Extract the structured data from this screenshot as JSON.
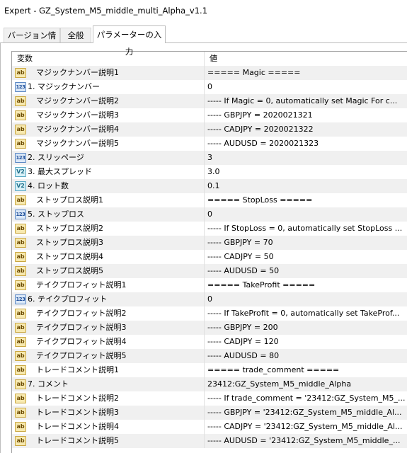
{
  "window": {
    "title": "Expert - GZ_System_M5_middle_multi_Alpha_v1.1"
  },
  "tabs": [
    {
      "label": "バージョン情報"
    },
    {
      "label": "全般"
    },
    {
      "label": "パラメーターの入力"
    }
  ],
  "table": {
    "columns": [
      "変数",
      "値"
    ],
    "rows": [
      {
        "icon": "ab",
        "indent": true,
        "name": "マジックナンバー説明1",
        "value": "===== Magic ====="
      },
      {
        "icon": "123",
        "indent": false,
        "name": "1. マジックナンバー",
        "value": "0"
      },
      {
        "icon": "ab",
        "indent": true,
        "name": "マジックナンバー説明2",
        "value": "----- If Magic = 0, automatically set Magic For c..."
      },
      {
        "icon": "ab",
        "indent": true,
        "name": "マジックナンバー説明3",
        "value": "----- GBPJPY = 2020021321"
      },
      {
        "icon": "ab",
        "indent": true,
        "name": "マジックナンバー説明4",
        "value": "----- CADJPY = 2020021322"
      },
      {
        "icon": "ab",
        "indent": true,
        "name": "マジックナンバー説明5",
        "value": "----- AUDUSD = 2020021323"
      },
      {
        "icon": "123",
        "indent": false,
        "name": "2. スリッページ",
        "value": "3"
      },
      {
        "icon": "v2",
        "indent": false,
        "name": "3. 最大スプレッド",
        "value": "3.0"
      },
      {
        "icon": "v2",
        "indent": false,
        "name": "4. ロット数",
        "value": "0.1"
      },
      {
        "icon": "ab",
        "indent": true,
        "name": "ストップロス説明1",
        "value": "===== StopLoss ====="
      },
      {
        "icon": "123",
        "indent": false,
        "name": "5. ストップロス",
        "value": "0"
      },
      {
        "icon": "ab",
        "indent": true,
        "name": "ストップロス説明2",
        "value": "----- If StopLoss = 0, automatically set StopLoss ..."
      },
      {
        "icon": "ab",
        "indent": true,
        "name": "ストップロス説明3",
        "value": "----- GBPJPY = 70"
      },
      {
        "icon": "ab",
        "indent": true,
        "name": "ストップロス説明4",
        "value": "----- CADJPY = 50"
      },
      {
        "icon": "ab",
        "indent": true,
        "name": "ストップロス説明5",
        "value": "----- AUDUSD = 50"
      },
      {
        "icon": "ab",
        "indent": true,
        "name": "テイクプロフィット説明1",
        "value": "===== TakeProfit ====="
      },
      {
        "icon": "123",
        "indent": false,
        "name": "6. テイクプロフィット",
        "value": "0"
      },
      {
        "icon": "ab",
        "indent": true,
        "name": "テイクプロフィット説明2",
        "value": "----- If TakeProfit = 0, automatically set TakeProf..."
      },
      {
        "icon": "ab",
        "indent": true,
        "name": "テイクプロフィット説明3",
        "value": "----- GBPJPY = 200"
      },
      {
        "icon": "ab",
        "indent": true,
        "name": "テイクプロフィット説明4",
        "value": "----- CADJPY = 120"
      },
      {
        "icon": "ab",
        "indent": true,
        "name": "テイクプロフィット説明5",
        "value": "----- AUDUSD = 80"
      },
      {
        "icon": "ab",
        "indent": true,
        "name": "トレードコメント説明1",
        "value": "===== trade_comment ====="
      },
      {
        "icon": "ab",
        "indent": false,
        "name": "7. コメント",
        "value": "23412:GZ_System_M5_middle_Alpha"
      },
      {
        "icon": "ab",
        "indent": true,
        "name": "トレードコメント説明2",
        "value": "----- If trade_comment = '23412:GZ_System_M5_..."
      },
      {
        "icon": "ab",
        "indent": true,
        "name": "トレードコメント説明3",
        "value": "----- GBPJPY = '23412:GZ_System_M5_middle_Al..."
      },
      {
        "icon": "ab",
        "indent": true,
        "name": "トレードコメント説明4",
        "value": "----- CADJPY = '23412:GZ_System_M5_middle_Al..."
      },
      {
        "icon": "ab",
        "indent": true,
        "name": "トレードコメント説明5",
        "value": "----- AUDUSD = '23412:GZ_System_M5_middle_..."
      }
    ]
  },
  "icons": {
    "ab": "string-type-icon",
    "123": "integer-type-icon",
    "v2": "double-type-icon"
  }
}
